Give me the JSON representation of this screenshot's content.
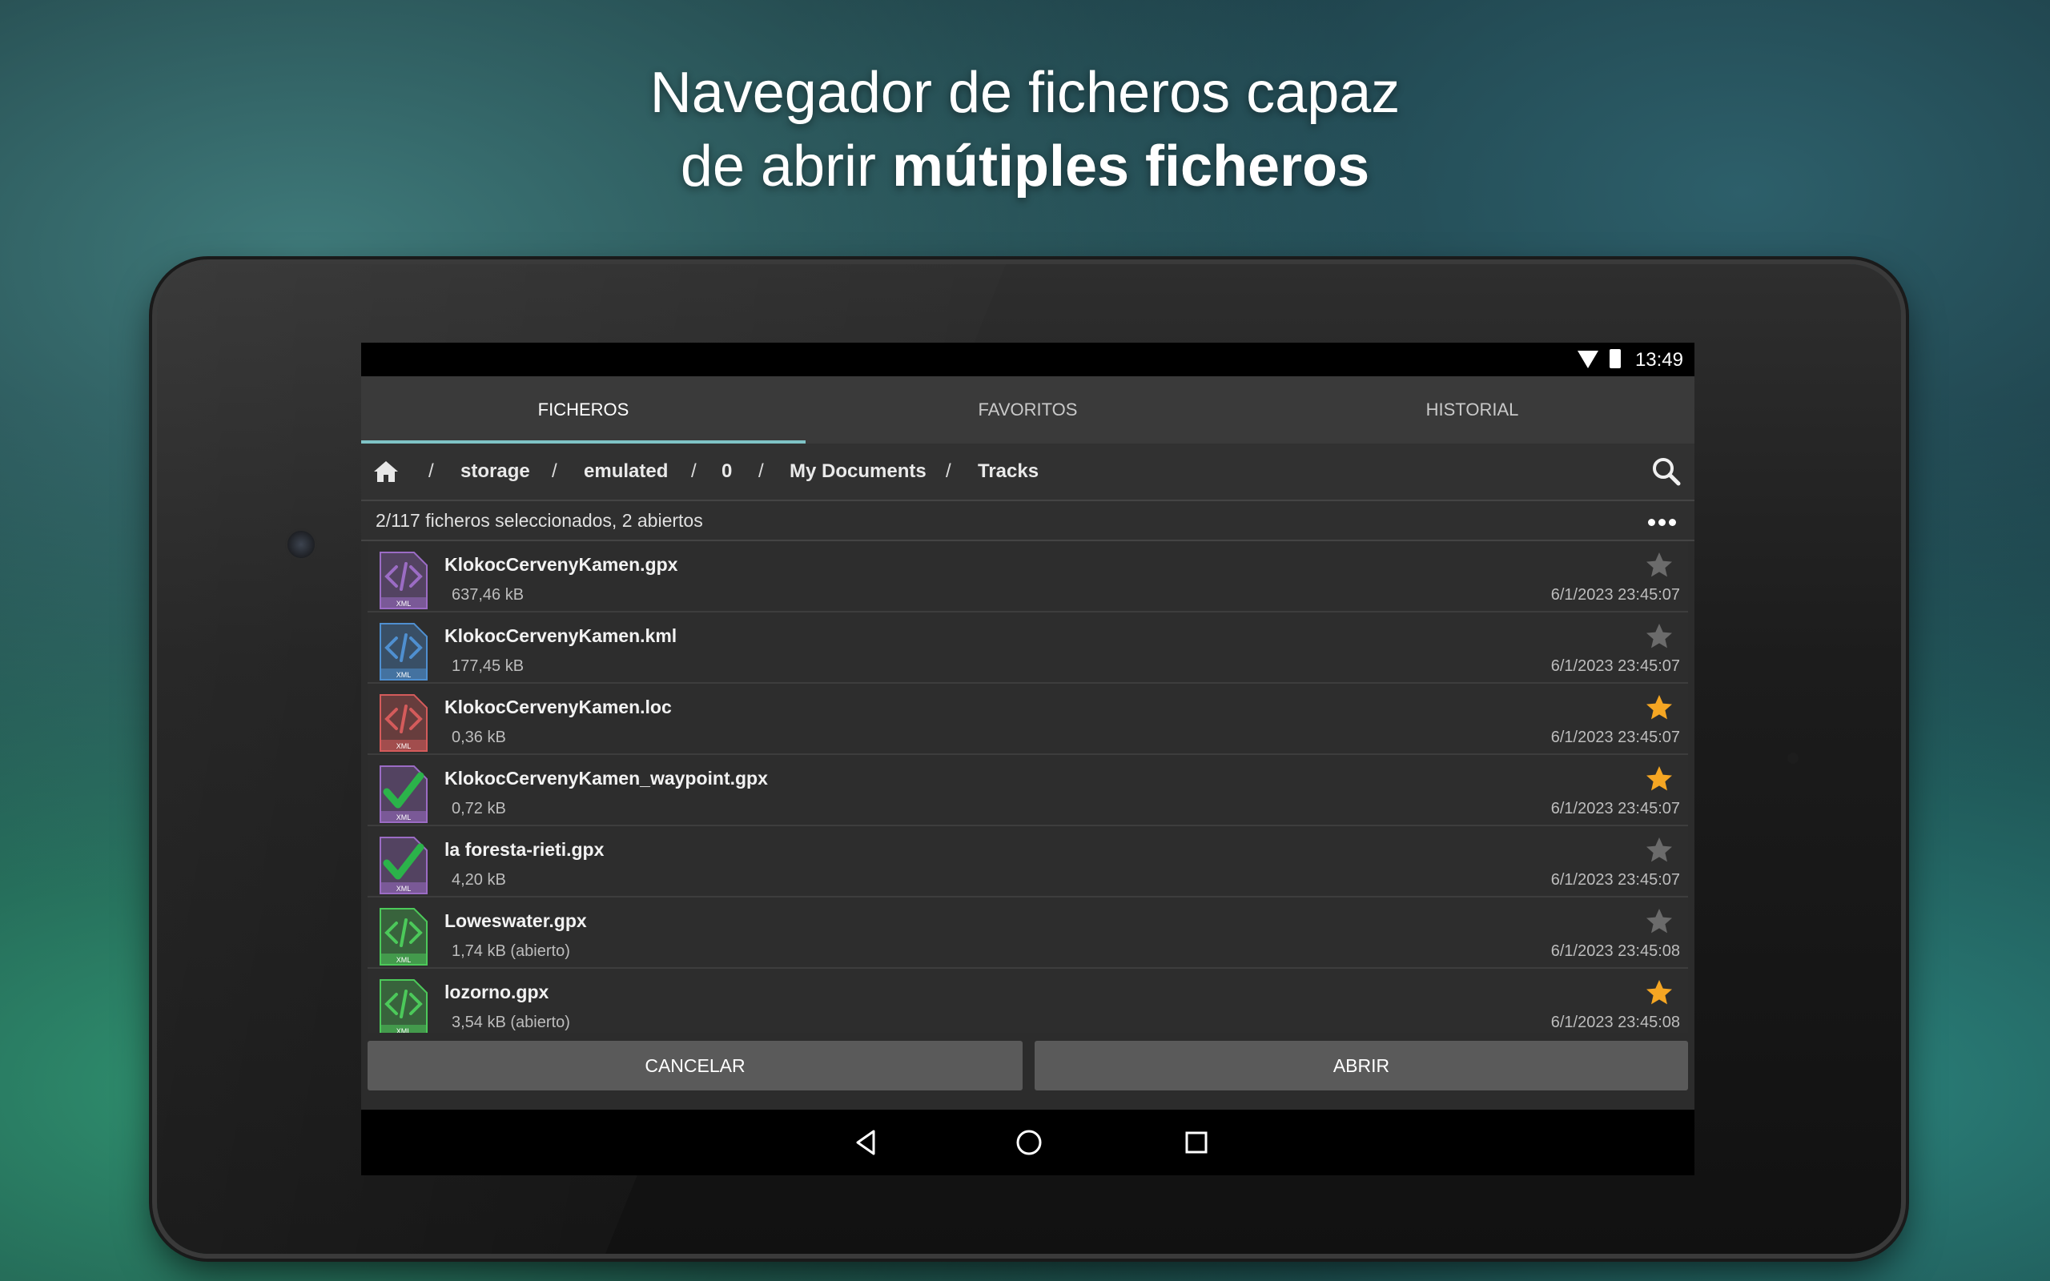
{
  "headline": {
    "line1": "Navegador de ficheros capaz",
    "line2_prefix": "de abrir ",
    "line2_bold": "mútiples ficheros"
  },
  "statusbar": {
    "time": "13:49",
    "icons": [
      "wifi-icon",
      "battery-icon"
    ]
  },
  "tabs": [
    {
      "label": "FICHEROS",
      "active": true
    },
    {
      "label": "FAVORITOS",
      "active": false
    },
    {
      "label": "HISTORIAL",
      "active": false
    }
  ],
  "breadcrumb": {
    "separator": "/",
    "items": [
      "storage",
      "emulated",
      "0",
      "My Documents",
      "Tracks"
    ]
  },
  "selection": {
    "text": "2/117 ficheros seleccionados, 2 abiertos"
  },
  "files": [
    {
      "name": "KlokocCervenyKamen.gpx",
      "size": "637,46 kB",
      "date": "6/1/2023 23:45:07",
      "favorite": false,
      "selected": false,
      "icon_color": "#9b6cc4"
    },
    {
      "name": "KlokocCervenyKamen.kml",
      "size": "177,45 kB",
      "date": "6/1/2023 23:45:07",
      "favorite": false,
      "selected": false,
      "icon_color": "#4f8fd0"
    },
    {
      "name": "KlokocCervenyKamen.loc",
      "size": "0,36 kB",
      "date": "6/1/2023 23:45:07",
      "favorite": true,
      "selected": false,
      "icon_color": "#d45b5b"
    },
    {
      "name": "KlokocCervenyKamen_waypoint.gpx",
      "size": "0,72 kB",
      "date": "6/1/2023 23:45:07",
      "favorite": true,
      "selected": true,
      "icon_color": "#9b6cc4"
    },
    {
      "name": "la foresta-rieti.gpx",
      "size": "4,20 kB",
      "date": "6/1/2023 23:45:07",
      "favorite": false,
      "selected": true,
      "icon_color": "#9b6cc4"
    },
    {
      "name": "Loweswater.gpx",
      "size": "1,74 kB (abierto)",
      "date": "6/1/2023 23:45:08",
      "favorite": false,
      "selected": false,
      "icon_color": "#4cc95a"
    },
    {
      "name": "lozorno.gpx",
      "size": "3,54 kB (abierto)",
      "date": "6/1/2023 23:45:08",
      "favorite": true,
      "selected": false,
      "icon_color": "#4cc95a"
    }
  ],
  "file_icon_label": "XML",
  "actions": {
    "cancel": "CANCELAR",
    "open": "ABRIR"
  },
  "colors": {
    "accent": "#7fc3c6",
    "star_active": "#f5a623",
    "star_inactive": "#6b6b6b"
  }
}
